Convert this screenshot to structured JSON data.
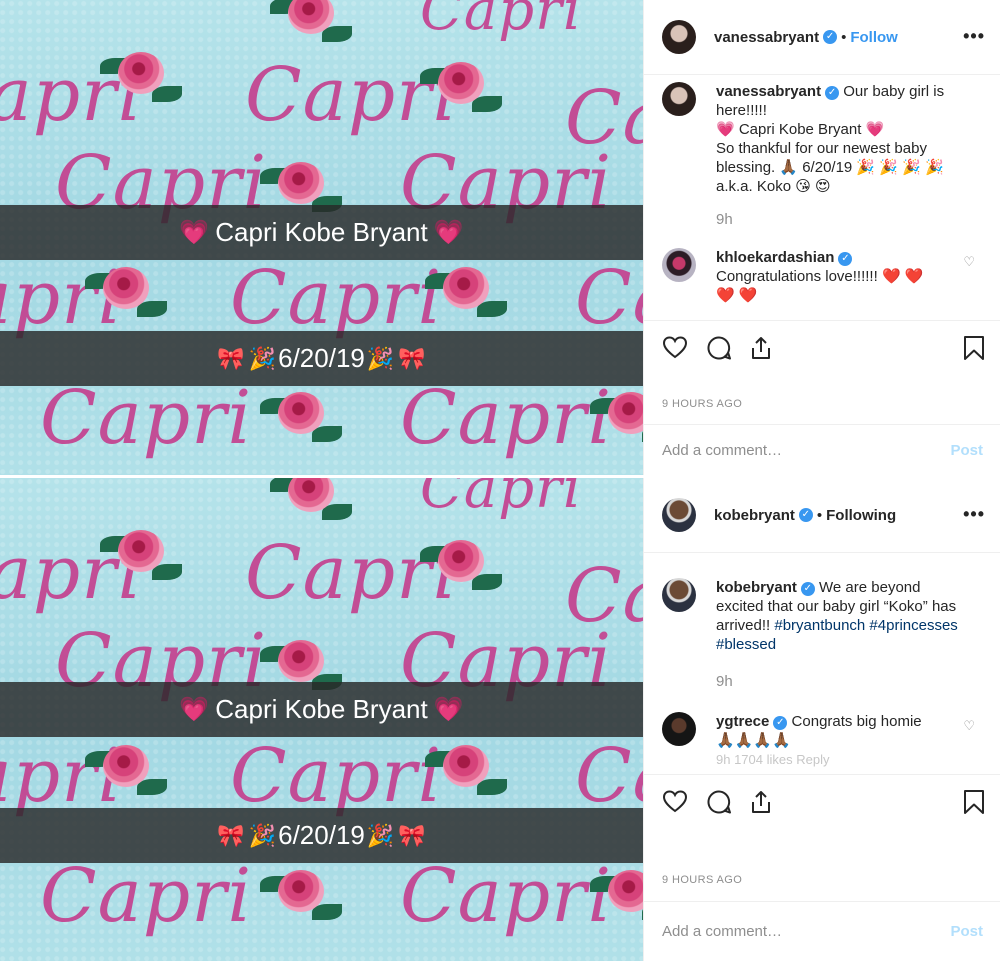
{
  "posts": [
    {
      "author": "vanessabryant",
      "follow_label": "Follow",
      "more_label": "•••",
      "photo": {
        "pattern_word": "Capri",
        "banner_name": "Capri Kobe Bryant",
        "banner_date": "6/20/19",
        "heart_glyph": "💗",
        "bow_glyph": "🎀",
        "party_glyph": "🎉"
      },
      "caption": {
        "username": "vanessabryant",
        "line1": "Our baby girl is here!!!!!",
        "line2": "💗 Capri Kobe Bryant 💗",
        "line3": "So thankful for our newest baby blessing. 🙏🏾 6/20/19 🎉 🎉 🎉 🎉",
        "line4": "a.k.a. Koko 😘 😍",
        "time": "9h"
      },
      "comment": {
        "username": "khloekardashian",
        "text": "Congratulations love!!!!!!",
        "hearts_line1": "❤️ ❤️",
        "hearts_line2": "❤️ ❤️"
      },
      "timestamp": "9 HOURS AGO",
      "add_comment_placeholder": "Add a comment…",
      "post_label": "Post"
    },
    {
      "author": "kobebryant",
      "follow_label": "Following",
      "more_label": "•••",
      "photo": {
        "pattern_word": "Capri",
        "banner_name": "Capri Kobe Bryant",
        "banner_date": "6/20/19",
        "heart_glyph": "💗",
        "bow_glyph": "🎀",
        "party_glyph": "🎉"
      },
      "caption": {
        "username": "kobebryant",
        "text": "We are beyond excited that our baby girl “Koko” has arrived!!",
        "tags": "#bryantbunch #4princesses #blessed",
        "time": "9h"
      },
      "comment": {
        "username": "ygtrece",
        "text": "Congrats big homie",
        "emoji": "🙏🏾🙏🏾🙏🏾🙏🏾",
        "meta_partial": "9h    1704 likes    Reply"
      },
      "timestamp": "9 HOURS AGO",
      "add_comment_placeholder": "Add a comment…",
      "post_label": "Post"
    }
  ],
  "icons": [
    "heart-icon",
    "comment-icon",
    "share-icon",
    "bookmark-icon",
    "verified-badge-icon",
    "more-options-icon"
  ],
  "colors": {
    "link_blue": "#3897f0",
    "text": "#262626",
    "muted": "#8e8e8e",
    "hashtag": "#003569",
    "post_disabled": "#b2dffc"
  }
}
